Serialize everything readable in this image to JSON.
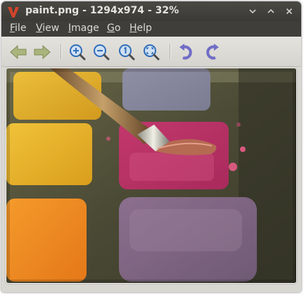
{
  "window": {
    "title": "paint.png - 1294x974 - 32%"
  },
  "menu": {
    "items": [
      {
        "label": "File",
        "mnemonic": "F",
        "rest": "ile"
      },
      {
        "label": "View",
        "mnemonic": "V",
        "rest": "iew"
      },
      {
        "label": "Image",
        "mnemonic": "I",
        "rest": "mage"
      },
      {
        "label": "Go",
        "mnemonic": "G",
        "rest": "o"
      },
      {
        "label": "Help",
        "mnemonic": "H",
        "rest": "elp"
      }
    ]
  },
  "toolbar": {
    "icons": [
      "back-arrow-icon",
      "forward-arrow-icon",
      "zoom-in-icon",
      "zoom-out-icon",
      "zoom-normal-icon",
      "zoom-fit-icon",
      "rotate-left-icon",
      "rotate-right-icon"
    ]
  },
  "image": {
    "description_icon": "photo-canvas"
  },
  "colors": {
    "titlebar": "#3c3b37",
    "menubar": "#3f3e3a",
    "toolbar": "#dedcd7",
    "nav_arrow": "#9aa86a",
    "zoom_icon": "#3d7bc8",
    "rotate_icon": "#7a78c9",
    "logo": "#d2452b"
  }
}
